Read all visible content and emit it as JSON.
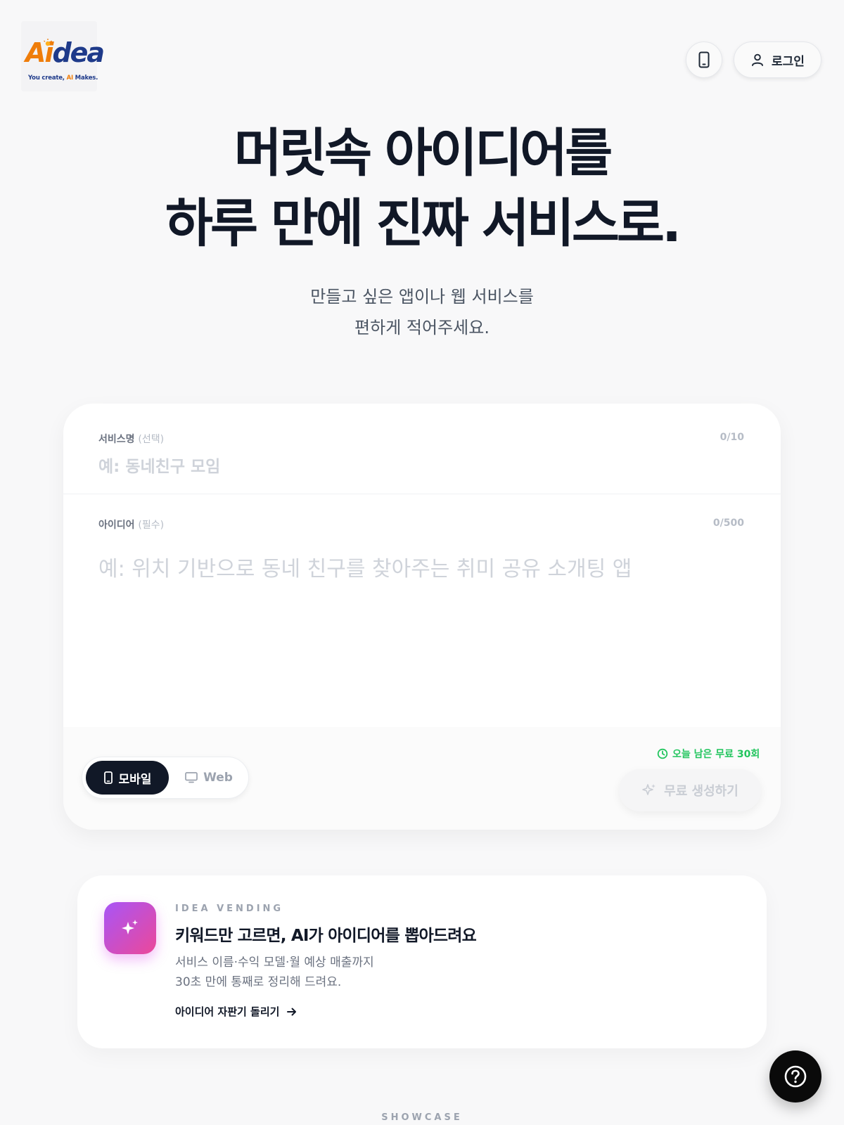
{
  "header": {
    "logo": {
      "word_a": "A",
      "word_i": "i",
      "word_dea": "dea",
      "tagline_pre": "You create, ",
      "tagline_ai": "AI",
      "tagline_post": " Makes."
    },
    "device_icon": "smartphone-icon",
    "login_label": "로그인",
    "login_icon": "user-icon"
  },
  "hero": {
    "title_line1": "머릿속 아이디어를",
    "title_line2": "하루 만에 진짜 서비스로.",
    "subtitle_line1": "만들고 싶은 앱이나 웹 서비스를",
    "subtitle_line2": "편하게 적어주세요."
  },
  "form": {
    "service_name": {
      "label": "서비스명",
      "label_hint": "(선택)",
      "counter": "0/10",
      "value": "",
      "placeholder": "예: 동네친구 모임"
    },
    "idea": {
      "label": "아이디어",
      "label_hint": "(필수)",
      "counter": "0/500",
      "value": "",
      "placeholder": "예: 위치 기반으로 동네 친구를 찾아주는 취미 공유 소개팅 앱"
    },
    "platform_toggle": {
      "options": [
        {
          "label": "모바일",
          "icon": "smartphone-icon",
          "selected": true
        },
        {
          "label": "Web",
          "icon": "monitor-icon",
          "selected": false
        }
      ]
    },
    "free_note": "오늘 남은 무료 30회",
    "free_note_icon": "clock-icon",
    "generate_label": "무료 생성하기",
    "generate_icon": "sparkle-icon"
  },
  "vending": {
    "icon": "sparkle-icon",
    "eyebrow": "IDEA VENDING",
    "title": "키워드만 고르면, AI가 아이디어를 뽑아드려요",
    "desc_line1": "서비스 이름·수익 모델·월 예상 매출까지",
    "desc_line2": "30초 만에 통째로 정리해 드려요.",
    "link_label": "아이디어 자판기 돌리기",
    "link_icon": "arrow-right-icon"
  },
  "showcase_label": "SHOWCASE",
  "help_icon": "help-circle-icon",
  "colors": {
    "brand_orange": "#ef7d0a",
    "brand_navy": "#1e3a8a",
    "ink": "#111827",
    "success_green": "#22c55e",
    "vending_gradient_start": "#a855f7",
    "vending_gradient_end": "#ec4899"
  }
}
